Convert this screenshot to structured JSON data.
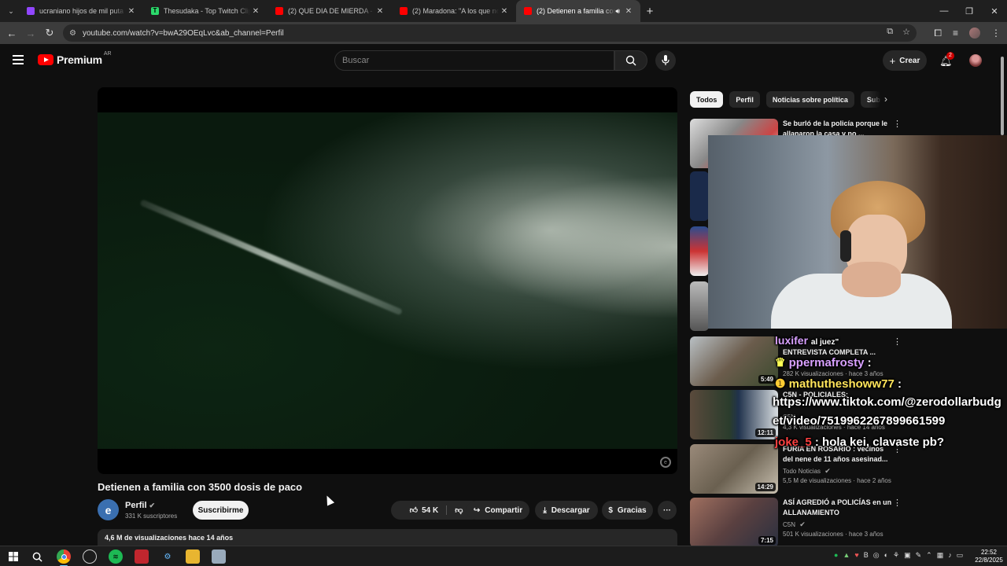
{
  "browser": {
    "tabs": [
      {
        "title": "ucraniano hijos de mil puta - Tw",
        "icon_color": "#9146ff"
      },
      {
        "title": "Thesudaka - Top Twitch Clips - T",
        "icon_color": "#2bd96b",
        "icon_text": "T"
      },
      {
        "title": "(2) QUE DIA DE MIERDA - YouT",
        "icon_color": "#ff0000"
      },
      {
        "title": "(2) Maradona: \"A los que no cre",
        "icon_color": "#ff0000"
      },
      {
        "title": "(2) Detienen a familia con 3",
        "icon_color": "#ff0000",
        "active": true
      }
    ],
    "url": "youtube.com/watch?v=bwA29OEqLvc&ab_channel=Perfil"
  },
  "header": {
    "logo_text": "Premium",
    "logo_country": "AR",
    "search_placeholder": "Buscar",
    "create_label": "Crear",
    "notif_count": "2"
  },
  "video": {
    "title": "Detienen a familia con 3500 dosis de paco",
    "channel": "Perfil",
    "channel_initial": "e",
    "subscribers": "331 K suscriptores",
    "subscribe_label": "Suscribirme",
    "likes": "54 K",
    "share_label": "Compartir",
    "download_label": "Descargar",
    "thanks_label": "Gracias",
    "views_date": "4,6 M de visualizaciones  hace 14 años"
  },
  "chips": [
    "Todos",
    "Perfil",
    "Noticias sobre política",
    "Sub"
  ],
  "recommendations": [
    {
      "title": "Se burló de la policía porque le allanaron la casa y no ...",
      "channel": "",
      "meta": "",
      "duration": ""
    },
    {
      "title": "ENTREVISTA COMPLETA ...",
      "channel": "",
      "meta": "282 K visualizaciones · hace 3 años",
      "duration": "5:49"
    },
    {
      "title": "C5N - POLICIALES:",
      "channel": "C5N",
      "meta": "4,3 K visualizaciones · hace 14 años",
      "duration": "12:11"
    },
    {
      "title": "FURIA EN ROSARIO : vecinos del nene de 11 años asesinad...",
      "channel": "Todo Noticias",
      "meta": "5,5 M de visualizaciones · hace 2 años",
      "duration": "14:29"
    },
    {
      "title": "ASÍ AGREDIÓ a POLICÍAS en un ALLANAMIENTO",
      "channel": "C5N",
      "meta": "501 K visualizaciones · hace 3 años",
      "duration": "7:15"
    }
  ],
  "chat": [
    {
      "user": "luxifer",
      "text": "al juez\""
    },
    {
      "user": "ppermafrosty",
      "text": ":"
    },
    {
      "user": "mathutheshoww77",
      "text": ":"
    },
    {
      "user": "",
      "text": "https://www.tiktok.com/@zerodollarbudg"
    },
    {
      "user": "",
      "text": "et/video/7519962267899661599"
    },
    {
      "user": "joke_5",
      "text": ": hola kei, clavaste pb?"
    }
  ],
  "taskbar": {
    "time": "22:52",
    "date": "22/8/2025"
  }
}
